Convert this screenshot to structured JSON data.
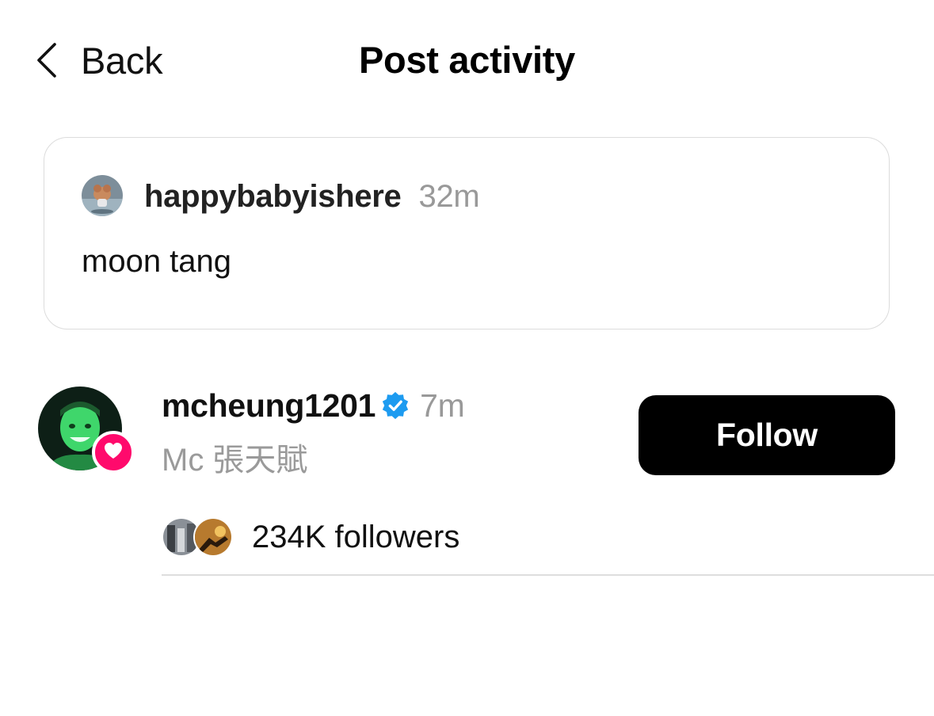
{
  "header": {
    "back_label": "Back",
    "title": "Post activity"
  },
  "post": {
    "author": "happybabyishere",
    "time": "32m",
    "text": "moon tang"
  },
  "activity": {
    "username": "mcheung1201",
    "verified": true,
    "time": "7m",
    "full_name": "Mc 張天賦",
    "action_icon": "heart-icon",
    "follow_label": "Follow",
    "followers_text": "234K followers"
  },
  "colors": {
    "like_badge": "#ff0a6c",
    "verified_badge": "#1d9bf0",
    "follow_button": "#000000",
    "secondary_text": "#999999"
  }
}
